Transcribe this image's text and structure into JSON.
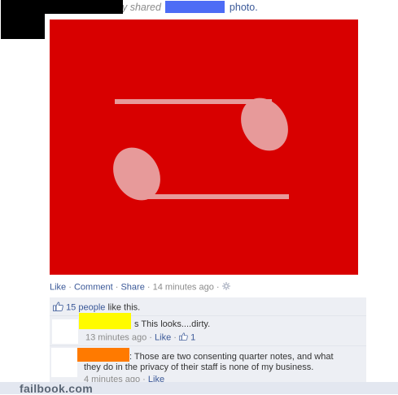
{
  "header": {
    "visible_suffix_1": "y shared",
    "visible_suffix_2": "photo."
  },
  "photo": {
    "background_color": "#d80000",
    "content": "two quarter-note shapes"
  },
  "action_bar": {
    "like_label": "Like",
    "comment_label": "Comment",
    "share_label": "Share",
    "separator": "·",
    "timestamp": "14 minutes ago",
    "gear_icon": "gear-icon"
  },
  "likes": {
    "count_text": "15 people",
    "suffix": "like this.",
    "icon": "thumbs-up-icon"
  },
  "comments": [
    {
      "text_visible": "s This looks....dirty.",
      "time": "13 minutes ago",
      "like_label": "Like",
      "like_count": "1",
      "redact_color": "#fffb00"
    },
    {
      "text_line1": ": Those are two consenting quarter notes, and what",
      "text_line2": "they do in the privacy of their staff is none of my business.",
      "time": "4 minutes ago",
      "like_label": "Like",
      "redact_color": "#ff7a00"
    }
  ],
  "watermark": {
    "text": "failbook.com"
  }
}
